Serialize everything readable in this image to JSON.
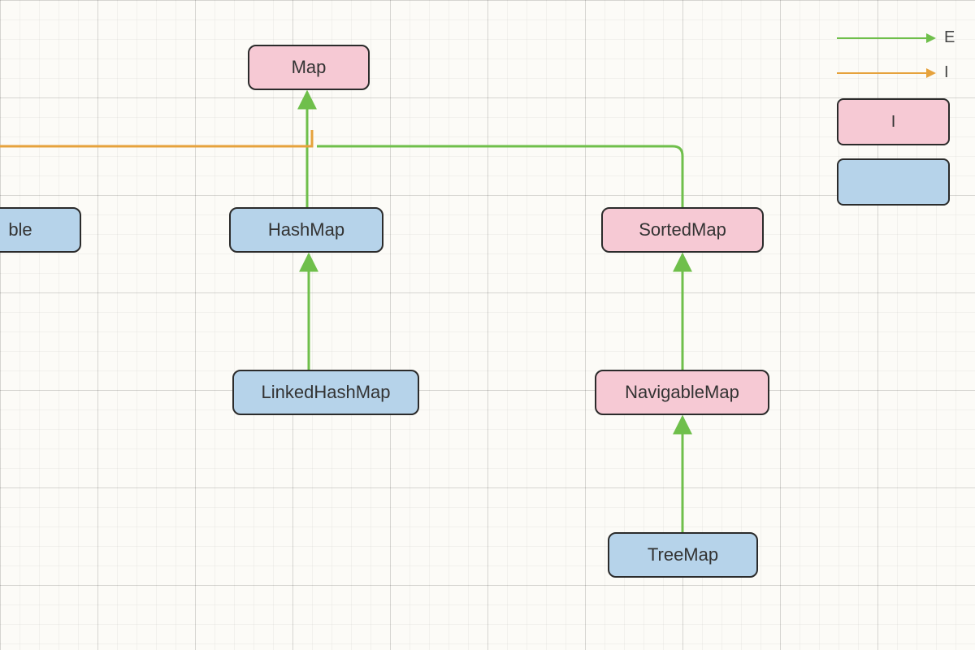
{
  "nodes": {
    "map": {
      "label": "Map",
      "kind": "interface"
    },
    "hashtable": {
      "label": "ble",
      "kind": "class"
    },
    "hashmap": {
      "label": "HashMap",
      "kind": "class"
    },
    "sortedmap": {
      "label": "SortedMap",
      "kind": "interface"
    },
    "linkedhashmap": {
      "label": "LinkedHashMap",
      "kind": "class"
    },
    "navigablemap": {
      "label": "NavigableMap",
      "kind": "interface"
    },
    "treemap": {
      "label": "TreeMap",
      "kind": "class"
    }
  },
  "legend": {
    "extends_label": "E",
    "implements_label": "I",
    "interface_label": "I",
    "class_label": ""
  },
  "colors": {
    "extends": "#6fbf4b",
    "implements": "#e6a23c",
    "interface_fill": "#f6c9d4",
    "class_fill": "#b6d3ea",
    "border": "#2b2b2b"
  },
  "edges": [
    {
      "from": "hashmap",
      "to": "map",
      "rel": "extends"
    },
    {
      "from": "sortedmap",
      "to": "map",
      "rel": "extends"
    },
    {
      "from": "hashtable",
      "to": "map",
      "rel": "implements"
    },
    {
      "from": "linkedhashmap",
      "to": "hashmap",
      "rel": "extends"
    },
    {
      "from": "navigablemap",
      "to": "sortedmap",
      "rel": "extends"
    },
    {
      "from": "treemap",
      "to": "navigablemap",
      "rel": "extends"
    }
  ]
}
